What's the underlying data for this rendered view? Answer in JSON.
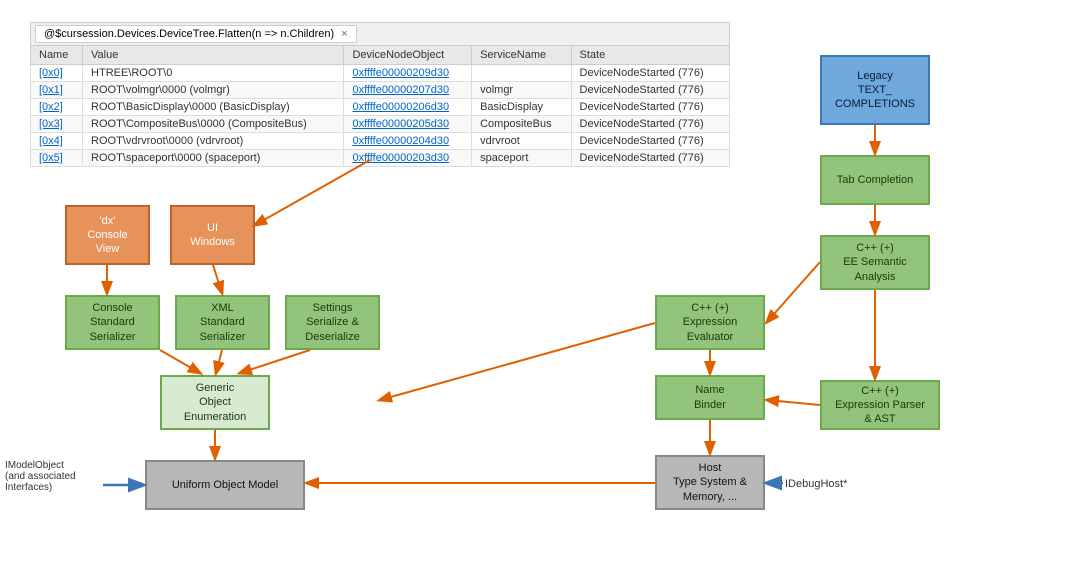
{
  "tab": {
    "label": "@$cursession.Devices.DeviceTree.Flatten(n => n.Children)",
    "close": "×"
  },
  "table": {
    "columns": [
      "Name",
      "Value",
      "DeviceNodeObject",
      "ServiceName",
      "State"
    ],
    "rows": [
      {
        "name": "[0x0]",
        "value": "HTREE\\ROOT\\0",
        "deviceNodeObject": "0xffffe00000209d30",
        "serviceName": "",
        "state": "DeviceNodeStarted (776)"
      },
      {
        "name": "[0x1]",
        "value": "ROOT\\volmgr\\0000 (volmgr)",
        "deviceNodeObject": "0xffffe00000207d30",
        "serviceName": "volmgr",
        "state": "DeviceNodeStarted (776)"
      },
      {
        "name": "[0x2]",
        "value": "ROOT\\BasicDisplay\\0000 (BasicDisplay)",
        "deviceNodeObject": "0xffffe00000206d30",
        "serviceName": "BasicDisplay",
        "state": "DeviceNodeStarted (776)"
      },
      {
        "name": "[0x3]",
        "value": "ROOT\\CompositeBus\\0000 (CompositeBus)",
        "deviceNodeObject": "0xffffe00000205d30",
        "serviceName": "CompositeBus",
        "state": "DeviceNodeStarted (776)"
      },
      {
        "name": "[0x4]",
        "value": "ROOT\\vdrvroot\\0000 (vdrvroot)",
        "deviceNodeObject": "0xffffe00000204d30",
        "serviceName": "vdrvroot",
        "state": "DeviceNodeStarted (776)"
      },
      {
        "name": "[0x5]",
        "value": "ROOT\\spaceport\\0000 (spaceport)",
        "deviceNodeObject": "0xffffe00000203d30",
        "serviceName": "spaceport",
        "state": "DeviceNodeStarted (776)"
      }
    ]
  },
  "boxes": {
    "legacy": {
      "label": "Legacy\nTEXT_\nCOMPLETIONS"
    },
    "tabCompletion": {
      "label": "Tab Completion"
    },
    "cppEE": {
      "label": "C++ (+)\nEE Semantic\nAnalysis"
    },
    "cppExpr": {
      "label": "C++ (+)\nExpression\nEvaluator"
    },
    "cppParser": {
      "label": "C++ (+)\nExpression Parser\n& AST"
    },
    "nameBinder": {
      "label": "Name\nBinder"
    },
    "hostTypeSystem": {
      "label": "Host\nType System &\nMemory, ..."
    },
    "consoleView": {
      "label": "'dx'\nConsole\nView"
    },
    "uiWindows": {
      "label": "UI\nWindows"
    },
    "consoleSerializer": {
      "label": "Console\nStandard\nSerializer"
    },
    "xmlSerializer": {
      "label": "XML\nStandard\nSerializer"
    },
    "settingsSerializer": {
      "label": "Settings\nSerialize &\nDeserialize"
    },
    "genericEnum": {
      "label": "Generic\nObject\nEnumeration"
    },
    "uniformModel": {
      "label": "Uniform Object Model"
    },
    "iModelObject": {
      "label": "IModelObject\n(and associated\nInterfaces)"
    },
    "iDebugHost": {
      "label": "IDebugHost*"
    }
  }
}
